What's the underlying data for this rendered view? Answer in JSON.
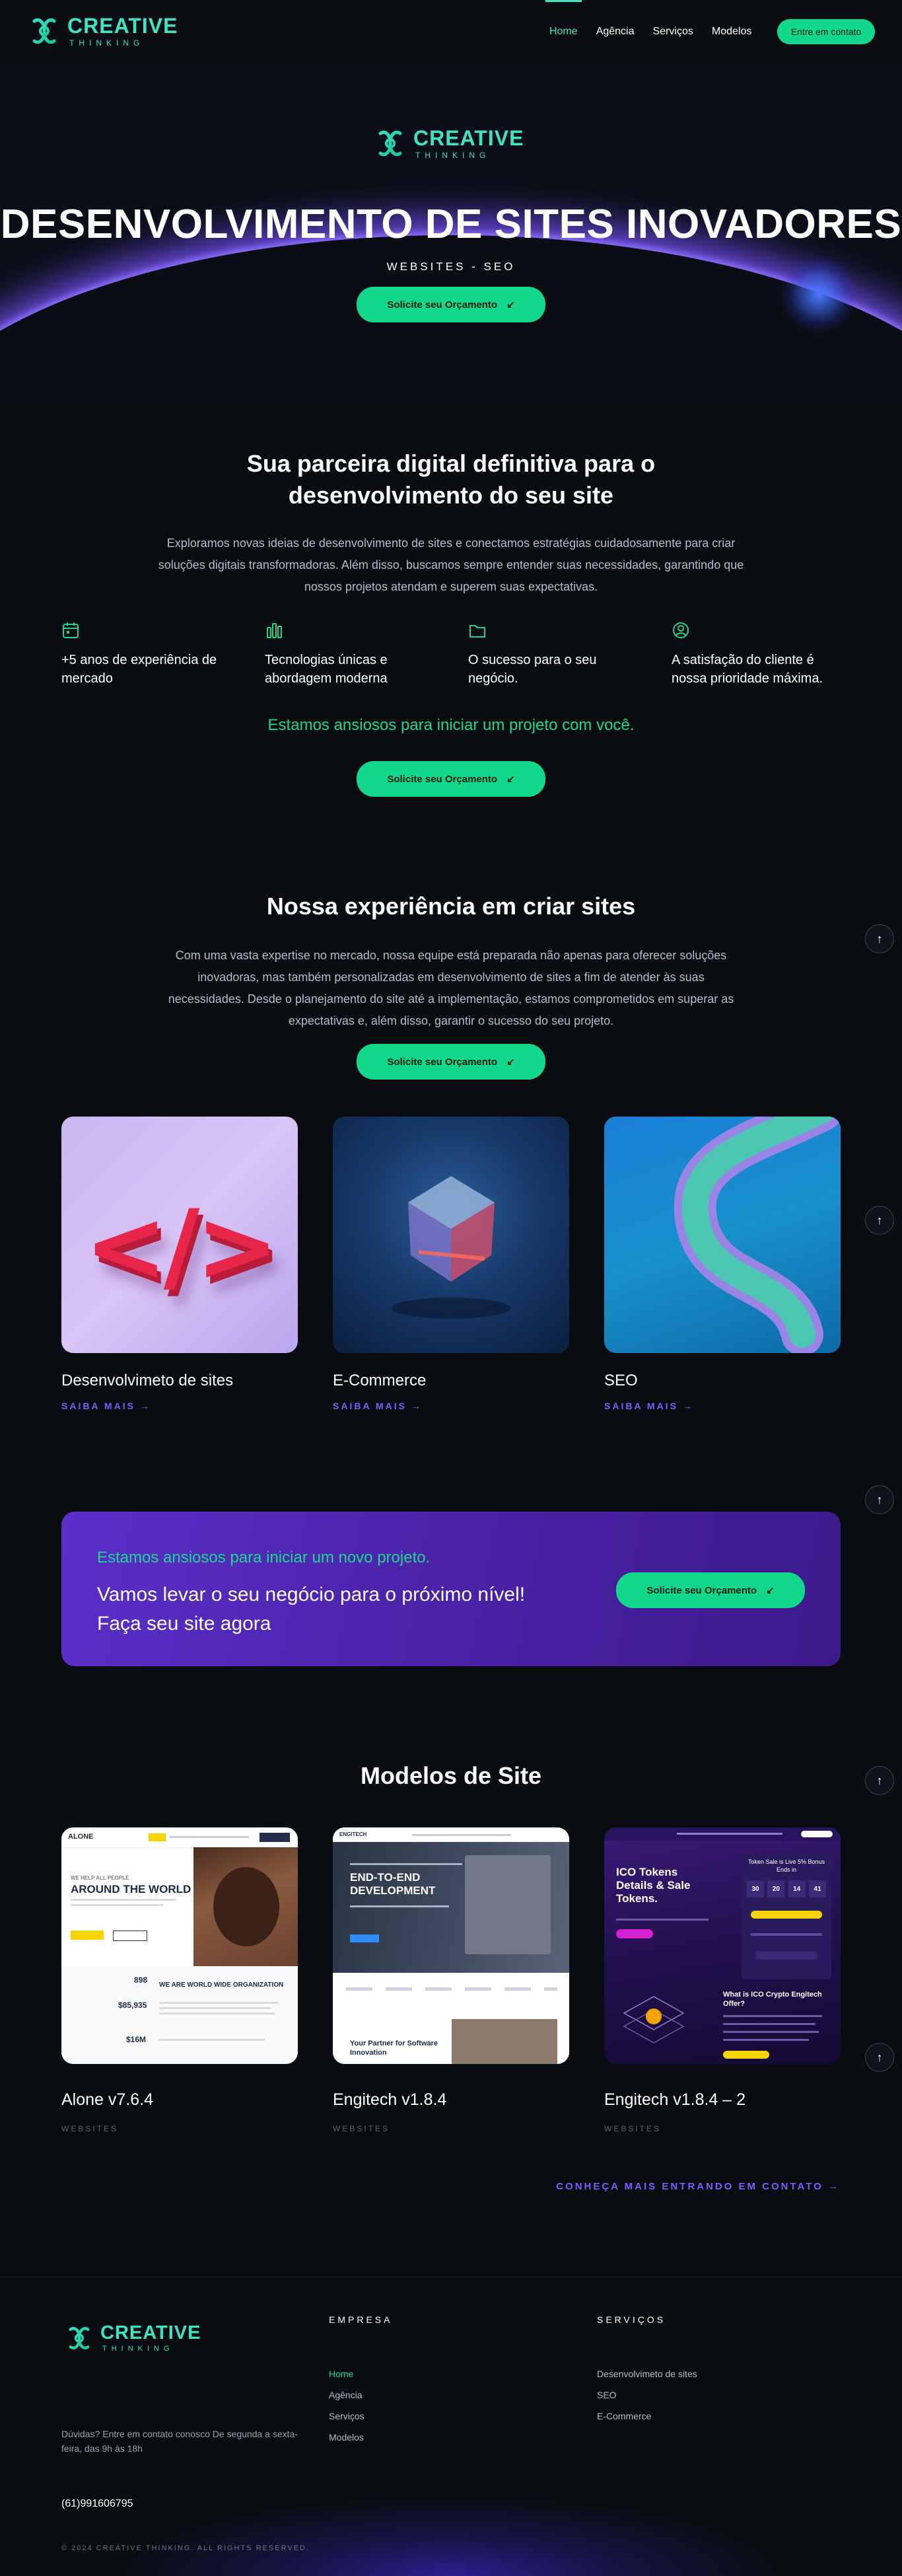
{
  "brand": {
    "name": "CREATIVE",
    "tagline": "THINKING"
  },
  "nav": {
    "items": [
      {
        "label": "Home",
        "active": true
      },
      {
        "label": "Agência",
        "active": false
      },
      {
        "label": "Serviços",
        "active": false
      },
      {
        "label": "Modelos",
        "active": false
      }
    ],
    "contact_label": "Entre em contato"
  },
  "hero": {
    "title": "DESENVOLVIMENTO DE SITES INOVADORES",
    "subtitle": "WEBSITES - SEO",
    "cta_label": "Solicite seu Orçamento"
  },
  "intro": {
    "title": "Sua parceira digital definitiva para o desenvolvimento do seu site",
    "paragraph": "Exploramos novas ideias de desenvolvimento de sites e conectamos estratégias cuidadosamente para criar soluções digitais transformadoras. Além disso, buscamos sempre entender suas necessidades, garantindo que nossos projetos atendam e superem suas expectativas.",
    "features": [
      {
        "icon": "calendar-icon",
        "text": "+5 anos de experiência de mercado"
      },
      {
        "icon": "bar-chart-icon",
        "text": "Tecnologias únicas e abordagem moderna"
      },
      {
        "icon": "folder-icon",
        "text": "O sucesso para o seu negócio."
      },
      {
        "icon": "user-circle-icon",
        "text": "A satisfação do cliente é nossa prioridade máxima."
      }
    ],
    "note": "Estamos ansiosos para iniciar um projeto com você.",
    "cta_label": "Solicite seu Orçamento"
  },
  "experience": {
    "title": "Nossa experiência em criar sites",
    "paragraph": "Com uma vasta expertise no mercado, nossa equipe está preparada não apenas para oferecer soluções inovadoras, mas também personalizadas em desenvolvimento de sites a fim de atender às suas necessidades. Desde o planejamento do site até a implementação, estamos comprometidos em superar as expectativas e, além disso, garantir o sucesso do seu projeto.",
    "cta_label": "Solicite seu Orçamento",
    "cards": [
      {
        "title": "Desenvolvimeto de sites",
        "link": "SAIBA MAIS"
      },
      {
        "title": "E-Commerce",
        "link": "SAIBA MAIS"
      },
      {
        "title": "SEO",
        "link": "SAIBA MAIS"
      }
    ]
  },
  "cta_banner": {
    "note": "Estamos ansiosos para iniciar um novo projeto.",
    "line1": "Vamos levar o seu negócio para o próximo nível!",
    "line2": "Faça seu site agora",
    "button_label": "Solicite seu Orçamento"
  },
  "templates": {
    "title": "Modelos de Site",
    "items": [
      {
        "title": "Alone v7.6.4",
        "tag": "WEBSITES",
        "preview": {
          "logo": "ALONE",
          "kicker": "WE HELP ALL PEOPLE",
          "headline": "AROUND THE WORLD",
          "stat1": "898",
          "stat2": "$85,935",
          "stat3": "$16M",
          "section": "WE ARE WORLD WIDE ORGANIZATION"
        }
      },
      {
        "title": "Engitech v1.8.4",
        "tag": "WEBSITES",
        "preview": {
          "logo": "ENGITECH",
          "headline": "END-TO-END DEVELOPMENT",
          "footer": "Your Partner for Software Innovation"
        }
      },
      {
        "title": "Engitech v1.8.4 – 2",
        "tag": "WEBSITES",
        "preview": {
          "headline": "ICO Tokens Details & Sale Tokens.",
          "box_title": "Token Sale is Live 5% Bonus Ends in",
          "d1": "30",
          "d2": "20",
          "d3": "14",
          "d4": "41",
          "offer": "What is ICO Crypto Engitech Offer?"
        }
      }
    ],
    "more_link": "CONHEÇA MAIS ENTRANDO EM CONTATO"
  },
  "footer": {
    "company_heading": "EMPRESA",
    "company_links": [
      "Home",
      "Agência",
      "Serviços",
      "Modelos"
    ],
    "services_heading": "SERVIÇOS",
    "services_links": [
      "Desenvolvimeto de sites",
      "SEO",
      "E-Commerce"
    ],
    "contact_text": "Dúvidas? Entre em contato conosco De segunda a sexta-feira, das 9h às 18h",
    "phone": "(61)991606795",
    "copyright": "© 2024 CREATIVE THINKING. ALL RIGHTS RESERVED."
  },
  "colors": {
    "accent": "#18d98d",
    "brand": "#3fe3c0",
    "purple": "#7d5cff",
    "background": "#090d12"
  }
}
